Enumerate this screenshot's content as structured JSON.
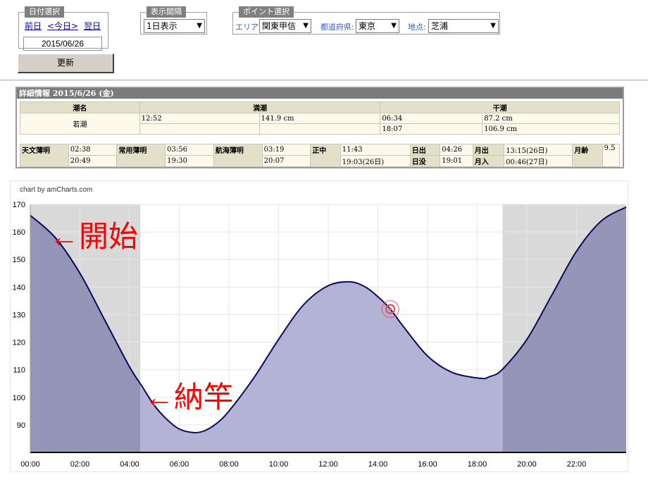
{
  "date_panel": {
    "legend": "日付選択",
    "prev": "前日",
    "today": "<今日>",
    "next": "翌日",
    "date": "2015/06/26",
    "update_button": "更新"
  },
  "interval_panel": {
    "legend": "表示間隔",
    "selected": "1日表示"
  },
  "point_panel": {
    "legend": "ポイント選択",
    "area_label": "エリア:",
    "area_value": "関東甲信",
    "pref_label": "都道府県:",
    "pref_value": "東京",
    "place_label": "地点:",
    "place_value": "芝浦"
  },
  "detail": {
    "title": "詳細情報  2015/6/26 (金)",
    "tide_name_header": "潮名",
    "high_header": "満潮",
    "low_header": "干潮",
    "tide_name": "若潮",
    "high_time_1": "12:52",
    "high_height_1": "141.9 cm",
    "high_time_2": "",
    "high_height_2": "",
    "low_time_1": "06:34",
    "low_height_1": "87.2 cm",
    "low_time_2": "18:07",
    "low_height_2": "106.9 cm",
    "astro_twilight_label": "天文薄明",
    "astro_twilight_1": "02:38",
    "astro_twilight_2": "20:49",
    "civil_twilight_label": "常用薄明",
    "civil_twilight_1": "03:56",
    "civil_twilight_2": "19:30",
    "nautical_twilight_label": "航海薄明",
    "nautical_twilight_1": "03:19",
    "nautical_twilight_2": "20:07",
    "noon_label": "正中",
    "noon_1": "11:43",
    "noon_2": "19:03(26日)",
    "sunrise_label": "日出",
    "sunrise": "04:26",
    "sunset_label": "日没",
    "sunset": "19:01",
    "moonrise_label": "月出",
    "moonrise": "13:15(26日)",
    "moonset_label": "月入",
    "moonset": "00:46(27日)",
    "moon_age_label": "月齢",
    "moon_age": "9.5"
  },
  "chart_credit": "chart by amCharts.com",
  "annotations": {
    "start": "←開始",
    "end": "←納竿"
  },
  "colors": {
    "night_band": "#d9d9d9",
    "fill_day": "#b3b3d6",
    "fill_night": "#9595b8",
    "line": "#0a0a5a",
    "annotation": "#ff0000",
    "marker": "#e05a6a"
  },
  "chart_data": {
    "type": "area",
    "x_unit": "hour of day",
    "xlim": [
      0,
      24
    ],
    "ylim": [
      80,
      170
    ],
    "x_ticks": [
      0,
      2,
      4,
      6,
      8,
      10,
      12,
      14,
      16,
      18,
      20,
      22
    ],
    "x_tick_labels": [
      "00:00",
      "02:00",
      "04:00",
      "06:00",
      "08:00",
      "10:00",
      "12:00",
      "14:00",
      "16:00",
      "18:00",
      "20:00",
      "22:00"
    ],
    "y_ticks": [
      90,
      100,
      110,
      120,
      130,
      140,
      150,
      160,
      170
    ],
    "grid": true,
    "x": [
      0,
      1,
      2,
      3,
      4,
      4.5,
      5,
      5.5,
      6,
      6.57,
      7,
      7.5,
      8,
      9,
      10,
      11,
      12,
      12.87,
      13.5,
      14,
      14.5,
      15,
      16,
      17,
      18.12,
      18.5,
      19,
      20,
      21,
      22,
      23,
      24
    ],
    "y": [
      166,
      158,
      145,
      128,
      111,
      104,
      97,
      92,
      88.5,
      87.2,
      87.8,
      90.5,
      95,
      107,
      121,
      133.5,
      140.5,
      141.9,
      140,
      136.5,
      132,
      126,
      115,
      109,
      106.9,
      107.5,
      110,
      121,
      137,
      153,
      164,
      169
    ],
    "night_bands": [
      [
        0,
        4.43
      ],
      [
        19.02,
        24
      ]
    ],
    "marker": {
      "x": 14.5,
      "y": 132
    }
  }
}
